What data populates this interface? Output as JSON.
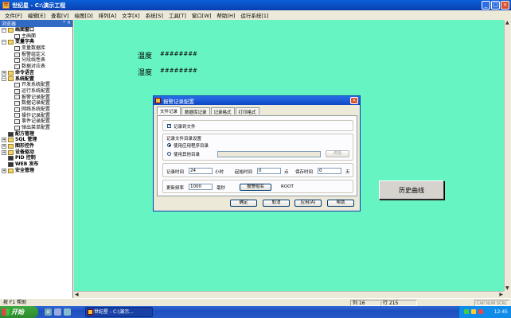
{
  "window": {
    "title": "世纪星 - C:\\演示工程",
    "app_icon": "app-icon"
  },
  "menu": [
    "文件[F]",
    "编辑[E]",
    "查看[V]",
    "绘图[D]",
    "排列[A]",
    "文字[X]",
    "系统[S]",
    "工具[T]",
    "窗口[W]",
    "帮助[H]",
    "运行系统[1]"
  ],
  "sidebar": {
    "title": "浏览器",
    "pin_icon": "pin-icon",
    "items": [
      {
        "label": "画面窗口",
        "level": 0,
        "toggle": "−",
        "icon": "folder",
        "bold": true
      },
      {
        "label": "主画面",
        "level": 1,
        "toggle": "",
        "icon": "page",
        "bold": false
      },
      {
        "label": "变量字典",
        "level": 0,
        "toggle": "−",
        "icon": "folder",
        "bold": true
      },
      {
        "label": "变量数据库",
        "level": 1,
        "toggle": "",
        "icon": "page",
        "bold": false
      },
      {
        "label": "报警组定义",
        "level": 1,
        "toggle": "",
        "icon": "page",
        "bold": false
      },
      {
        "label": "分段线性表",
        "level": 1,
        "toggle": "",
        "icon": "page",
        "bold": false
      },
      {
        "label": "数据对应表",
        "level": 1,
        "toggle": "",
        "icon": "page",
        "bold": false
      },
      {
        "label": "命令语言",
        "level": 0,
        "toggle": "+",
        "icon": "folder",
        "bold": true
      },
      {
        "label": "系统配置",
        "level": 0,
        "toggle": "−",
        "icon": "folder",
        "bold": true
      },
      {
        "label": "开发系统配置",
        "level": 1,
        "toggle": "",
        "icon": "page",
        "bold": false
      },
      {
        "label": "运行系统配置",
        "level": 1,
        "toggle": "",
        "icon": "page",
        "bold": false
      },
      {
        "label": "报警记录配置",
        "level": 1,
        "toggle": "",
        "icon": "page",
        "bold": false
      },
      {
        "label": "数据记录配置",
        "level": 1,
        "toggle": "",
        "icon": "page",
        "bold": false
      },
      {
        "label": "网络系统配置",
        "level": 1,
        "toggle": "",
        "icon": "page",
        "bold": false
      },
      {
        "label": "操作记录配置",
        "level": 1,
        "toggle": "",
        "icon": "page",
        "bold": false
      },
      {
        "label": "事件记录配置",
        "level": 1,
        "toggle": "",
        "icon": "page",
        "bold": false
      },
      {
        "label": "弹出菜单配置",
        "level": 1,
        "toggle": "",
        "icon": "page",
        "bold": false
      },
      {
        "label": "配方管理",
        "level": 0,
        "toggle": "",
        "icon": "dark",
        "bold": true
      },
      {
        "label": "SQL 管理",
        "level": 0,
        "toggle": "+",
        "icon": "folder",
        "bold": true
      },
      {
        "label": "图形控件",
        "level": 0,
        "toggle": "+",
        "icon": "folder",
        "bold": true
      },
      {
        "label": "设备驱动",
        "level": 0,
        "toggle": "+",
        "icon": "folder",
        "bold": true
      },
      {
        "label": "PID 控制",
        "level": 0,
        "toggle": "",
        "icon": "dark",
        "bold": true
      },
      {
        "label": "WEB 发布",
        "level": 0,
        "toggle": "",
        "icon": "dark",
        "bold": true
      },
      {
        "label": "安全管理",
        "level": 0,
        "toggle": "+",
        "icon": "folder",
        "bold": true
      }
    ]
  },
  "canvas": {
    "temp_label": "温度",
    "temp_value": "########",
    "hum_label": "湿度",
    "hum_value": "########",
    "history_button": "历史曲线",
    "bg_color": "#67f4c3"
  },
  "dialog": {
    "title": "报警记录配置",
    "tabs": [
      "文件记录",
      "数据库记录",
      "记录格式",
      "打印格式"
    ],
    "record_to_file": "记录到文件",
    "dir_group_title": "记录文件目录设置",
    "use_app_dir": "使用应用程序目录",
    "use_other_dir": "使用其他目录",
    "browse": "浏览",
    "record_time_label": "记录时间",
    "record_time_value": "24",
    "hour_unit": "小时",
    "start_time_label": "起始时间",
    "start_time_value": "0",
    "point_unit": "点",
    "keep_time_label": "保存时间",
    "keep_time_value": "0",
    "day_unit": "天",
    "refresh_label": "更新频率",
    "refresh_value": "1000",
    "ms_unit": "毫秒",
    "alarm_group_button": "报警组名",
    "alarm_group_value": "ROOT",
    "ok": "确定",
    "cancel": "取消",
    "apply": "应用(A)",
    "help": "帮助"
  },
  "status": {
    "help": "按 F1 帮助",
    "col": "列 16",
    "row": "行 215",
    "keys": "CAP NUM SCRL"
  },
  "taskbar": {
    "start": "开始",
    "task": "世纪星 - C:\\演示...",
    "clock": "12:45"
  }
}
